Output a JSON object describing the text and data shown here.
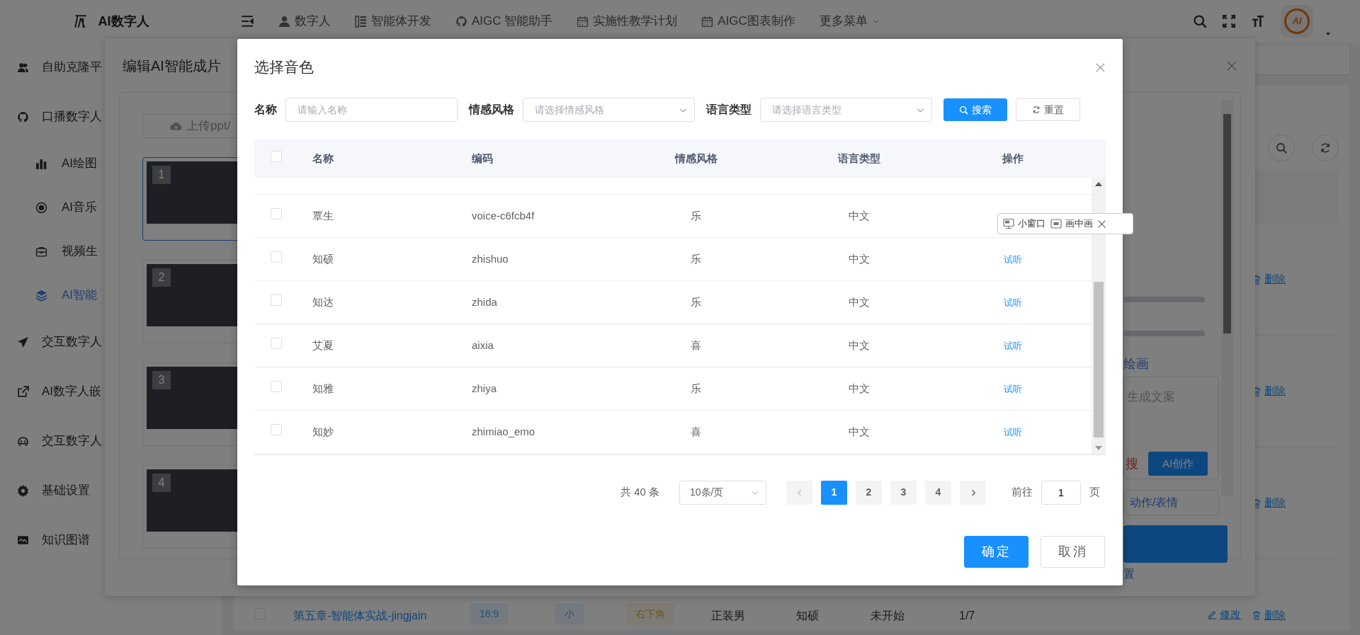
{
  "app": {
    "title": "AI数字人"
  },
  "top_nav": {
    "items": [
      {
        "label": "数字人",
        "kind": "link"
      },
      {
        "label": "智能体开发",
        "kind": "link"
      },
      {
        "label": "AIGC 智能助手",
        "kind": "link"
      },
      {
        "label": "实施性教学计划",
        "kind": "link"
      },
      {
        "label": "AIGC图表制作",
        "kind": "link"
      },
      {
        "label": "更多菜单",
        "kind": "dropdown"
      }
    ],
    "avatar_text": "AI"
  },
  "sidebar": {
    "items": [
      {
        "label": "自助克隆平",
        "selected": false
      },
      {
        "label": "口播数字人",
        "selected": false,
        "expanded": true,
        "children": [
          {
            "label": "AI绘图",
            "selected": false
          },
          {
            "label": "AI音乐",
            "selected": false
          },
          {
            "label": "视频生",
            "selected": false
          },
          {
            "label": "AI智能",
            "selected": true
          }
        ]
      },
      {
        "label": "交互数字人",
        "selected": false
      },
      {
        "label": "AI数字人嵌",
        "selected": false
      },
      {
        "label": "交互数字人",
        "selected": false
      },
      {
        "label": "基础设置",
        "selected": false
      },
      {
        "label": "知识图谱",
        "selected": false
      }
    ]
  },
  "background_dialog": {
    "title": "编辑AI智能成片",
    "upload_button": "上传ppt/",
    "slides": [
      {
        "number": "1",
        "selected": true
      },
      {
        "number": "2",
        "selected": false
      },
      {
        "number": "3",
        "selected": false
      },
      {
        "number": "4",
        "selected": false
      }
    ],
    "section_title": "绘画",
    "prompt_placeholder": "生成文案",
    "search_hint": "搜",
    "create_button": "AI创作",
    "motion_card": "动作/表情",
    "settings_link": "置"
  },
  "main_table": {
    "rows": [
      {
        "delete": "删除"
      },
      {
        "delete": "删除"
      },
      {
        "delete": "删除"
      },
      {
        "checked": false,
        "title": "第五章-智能体实战-jingjain",
        "ratio": "16:9",
        "size": "小",
        "position": "右下角",
        "outfit": "正装男",
        "voice": "知硕",
        "status": "未开始",
        "progress": "1/7",
        "edit": "修改",
        "delete": "删除"
      }
    ]
  },
  "modal": {
    "title": "选择音色",
    "filters": [
      {
        "label": "名称",
        "placeholder": "请输入名称",
        "kind": "input"
      },
      {
        "label": "情感风格",
        "placeholder": "请选择情感风格",
        "kind": "select"
      },
      {
        "label": "语言类型",
        "placeholder": "请选择语言类型",
        "kind": "select"
      }
    ],
    "search_button": "搜索",
    "reset_button": "重置",
    "table": {
      "select_all_checked": false,
      "columns": [
        "名称",
        "编码",
        "情感风格",
        "语言类型",
        "操作"
      ],
      "rows": [
        {
          "checked": false,
          "name": "覃生",
          "code": "voice-c6fcb4f",
          "emotion": "乐",
          "language": "中文"
        },
        {
          "checked": false,
          "name": "知硕",
          "code": "zhishuo",
          "emotion": "乐",
          "language": "中文",
          "action": "试听"
        },
        {
          "checked": false,
          "name": "知达",
          "code": "zhida",
          "emotion": "乐",
          "language": "中文",
          "action": "试听"
        },
        {
          "checked": false,
          "name": "艾夏",
          "code": "aixia",
          "emotion": "喜",
          "language": "中文",
          "action": "试听"
        },
        {
          "checked": false,
          "name": "知雅",
          "code": "zhiya",
          "emotion": "乐",
          "language": "中文",
          "action": "试听"
        },
        {
          "checked": false,
          "name": "知妙",
          "code": "zhimiao_emo",
          "emotion": "喜",
          "language": "中文",
          "action": "试听"
        }
      ]
    },
    "pagination": {
      "total": "共 40 条",
      "page_size": "10条/页",
      "pages": [
        {
          "label": "1",
          "selected": true
        },
        {
          "label": "2",
          "selected": false
        },
        {
          "label": "3",
          "selected": false
        },
        {
          "label": "4",
          "selected": false
        }
      ],
      "goto_label": "前往",
      "goto_value": "1",
      "goto_suffix": "页"
    },
    "buttons": [
      {
        "label": "确定",
        "kind": "primary"
      },
      {
        "label": "取消",
        "kind": "secondary"
      }
    ]
  },
  "pip_popup": {
    "items": [
      "小窗口",
      "画中画"
    ]
  }
}
